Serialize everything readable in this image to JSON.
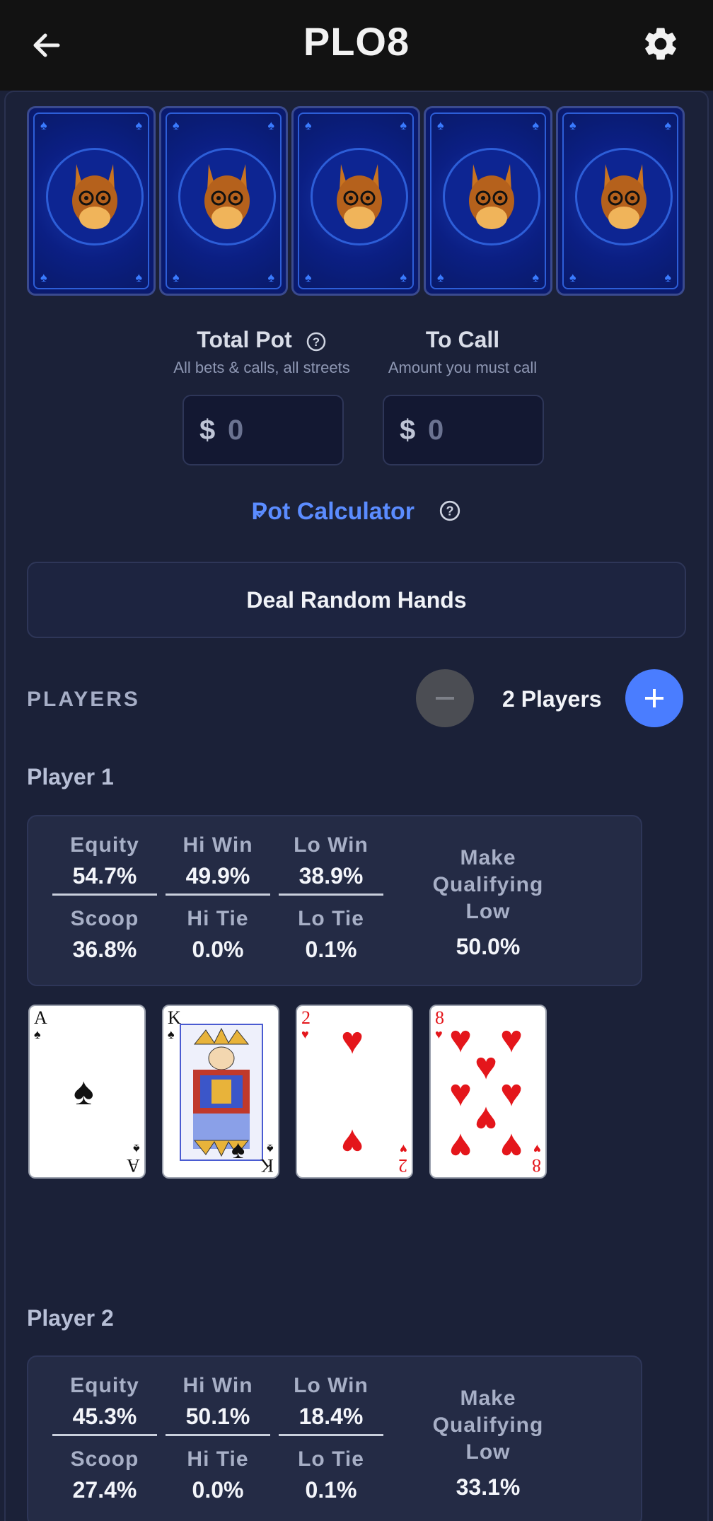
{
  "header": {
    "title": "PLO8",
    "back_icon": "arrow-left-icon",
    "settings_icon": "gear-icon"
  },
  "board": {
    "cards": [
      {
        "state": "face-down"
      },
      {
        "state": "face-down"
      },
      {
        "state": "face-down"
      },
      {
        "state": "face-down"
      },
      {
        "state": "face-down"
      }
    ]
  },
  "pot": {
    "total_label": "Total Pot",
    "total_sub": "All bets & calls, all streets",
    "total_currency": "$",
    "total_value": "0",
    "call_label": "To Call",
    "call_sub": "Amount you must call",
    "call_currency": "$",
    "call_value": "0"
  },
  "pot_calculator": {
    "label": "Pot Calculator"
  },
  "deal_button": {
    "label": "Deal Random Hands"
  },
  "players_section": {
    "label": "PLAYERS",
    "count_label": "2 Players"
  },
  "players": [
    {
      "name": "Player 1",
      "stats": {
        "equity_label": "Equity",
        "equity": "54.7%",
        "hi_win_label": "Hi Win",
        "hi_win": "49.9%",
        "lo_win_label": "Lo Win",
        "lo_win": "38.9%",
        "scoop_label": "Scoop",
        "scoop": "36.8%",
        "hi_tie_label": "Hi Tie",
        "hi_tie": "0.0%",
        "lo_tie_label": "Lo Tie",
        "lo_tie": "0.1%",
        "mql_line1": "Make",
        "mql_line2": "Qualifying",
        "mql_line3": "Low",
        "mql": "50.0%"
      },
      "cards": [
        {
          "rank": "A",
          "suit": "♠"
        },
        {
          "rank": "K",
          "suit": "♠"
        },
        {
          "rank": "2",
          "suit": "♥"
        },
        {
          "rank": "8",
          "suit": "♥"
        }
      ]
    },
    {
      "name": "Player 2",
      "stats": {
        "equity_label": "Equity",
        "equity": "45.3%",
        "hi_win_label": "Hi Win",
        "hi_win": "50.1%",
        "lo_win_label": "Lo Win",
        "lo_win": "18.4%",
        "scoop_label": "Scoop",
        "scoop": "27.4%",
        "hi_tie_label": "Hi Tie",
        "hi_tie": "0.0%",
        "lo_tie_label": "Lo Tie",
        "lo_tie": "0.1%",
        "mql_line1": "Make",
        "mql_line2": "Qualifying",
        "mql_line3": "Low",
        "mql": "33.1%"
      }
    }
  ],
  "colors": {
    "background": "#1b2138",
    "accent": "#5b8cff",
    "plus_button": "#4a7dff",
    "card_back": "#0a1a6e"
  }
}
